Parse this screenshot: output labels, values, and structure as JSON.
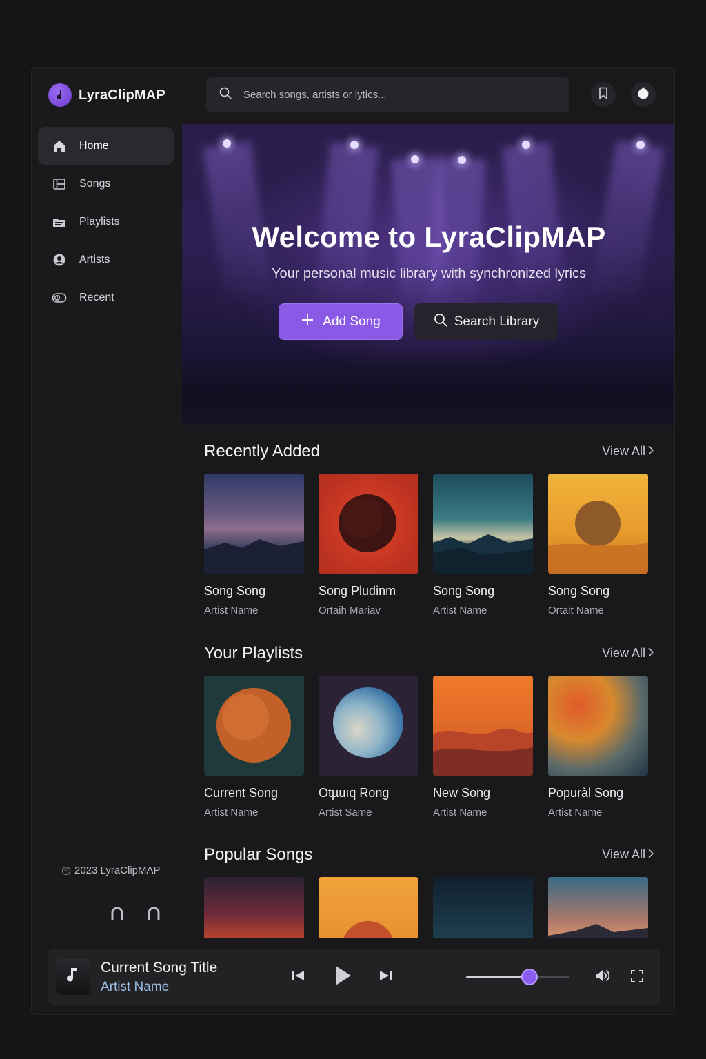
{
  "brand": {
    "name": "LyraClipMAP"
  },
  "search": {
    "placeholder": "Search songs, artists or lytics..."
  },
  "nav": [
    {
      "label": "Home",
      "icon": "home-icon",
      "active": true
    },
    {
      "label": "Songs",
      "icon": "film-icon",
      "active": false
    },
    {
      "label": "Playlists",
      "icon": "folder-icon",
      "active": false
    },
    {
      "label": "Artists",
      "icon": "user-circle-icon",
      "active": false
    },
    {
      "label": "Recent",
      "icon": "history-icon",
      "active": false
    }
  ],
  "footer": {
    "copyright": "2023 LyraClipMAP"
  },
  "hero": {
    "title": "Welcome to LyraClipMAP",
    "subtitle": "Your personal music library with synchronized lyrics",
    "add_label": "Add Song",
    "search_label": "Search Library"
  },
  "sections": {
    "recent": {
      "title": "Recently Added",
      "view_all": "View All",
      "cards": [
        {
          "title": "Song Song",
          "artist": "Artist Name"
        },
        {
          "title": "Song Pludinm",
          "artist": "Ortaih Mariav"
        },
        {
          "title": "Song Song",
          "artist": "Artist Name"
        },
        {
          "title": "Song Song",
          "artist": "Ortait Name"
        }
      ]
    },
    "playlists": {
      "title": "Your Playlists",
      "view_all": "View All",
      "cards": [
        {
          "title": "Current Song",
          "artist": "Artist Name"
        },
        {
          "title": "Otµuıq Rong",
          "artist": "Artist Same"
        },
        {
          "title": "New Song",
          "artist": "Artist Name"
        },
        {
          "title": "Popuràl Song",
          "artist": "Artist Name"
        }
      ]
    },
    "popular": {
      "title": "Popular Songs",
      "view_all": "View All"
    }
  },
  "player": {
    "title": "Current Song Title",
    "artist": "Artist Name",
    "volume": 0.61
  },
  "colors": {
    "accent": "#8a59e6",
    "background": "#19191b",
    "artist_link": "#9bbde6"
  }
}
